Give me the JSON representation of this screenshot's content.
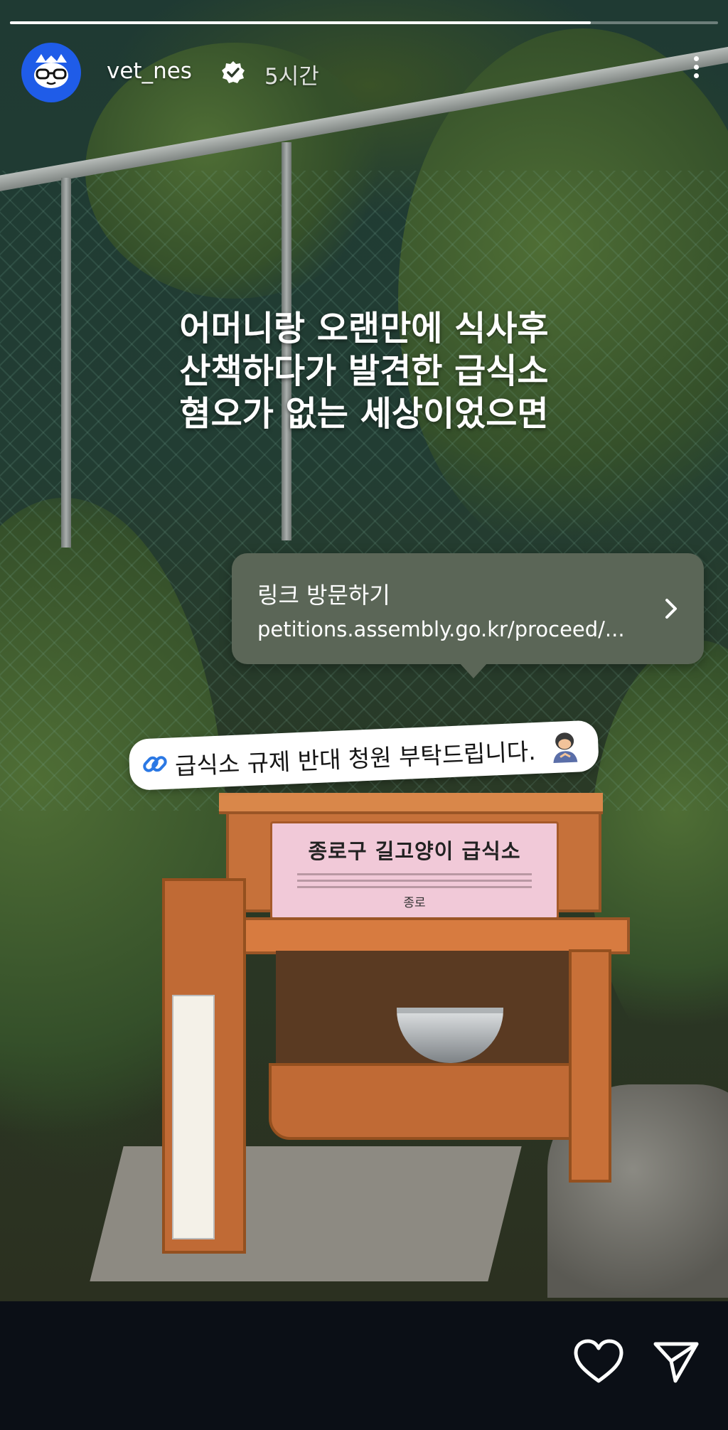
{
  "story": {
    "progress": 0.82
  },
  "header": {
    "username": "vet_nes",
    "verified_icon": "verified-badge-icon",
    "time_ago": "5시간",
    "menu_icon": "more-vertical-icon"
  },
  "caption": {
    "lines": [
      "어머니랑 오랜만에 식사후",
      "산책하다가 발견한 급식소",
      "혐오가 없는 세상이었으면"
    ]
  },
  "link_card": {
    "title": "링크 방문하기",
    "url": "petitions.assembly.go.kr/proceed/...",
    "icon": "chevron-right-icon"
  },
  "sticker": {
    "text": "급식소 규제 반대 청원 부탁드립니다.",
    "icon": "link-icon",
    "emoji": "person-bowing-emoji"
  },
  "photo_sign": {
    "title": "종로구 길고양이 급식소",
    "footer": "종로"
  },
  "footer": {
    "like_icon": "heart-icon",
    "share_icon": "send-icon"
  },
  "colors": {
    "background": "#0b0f16",
    "link_card": "#5b6657",
    "avatar": "#1f5ce8"
  }
}
